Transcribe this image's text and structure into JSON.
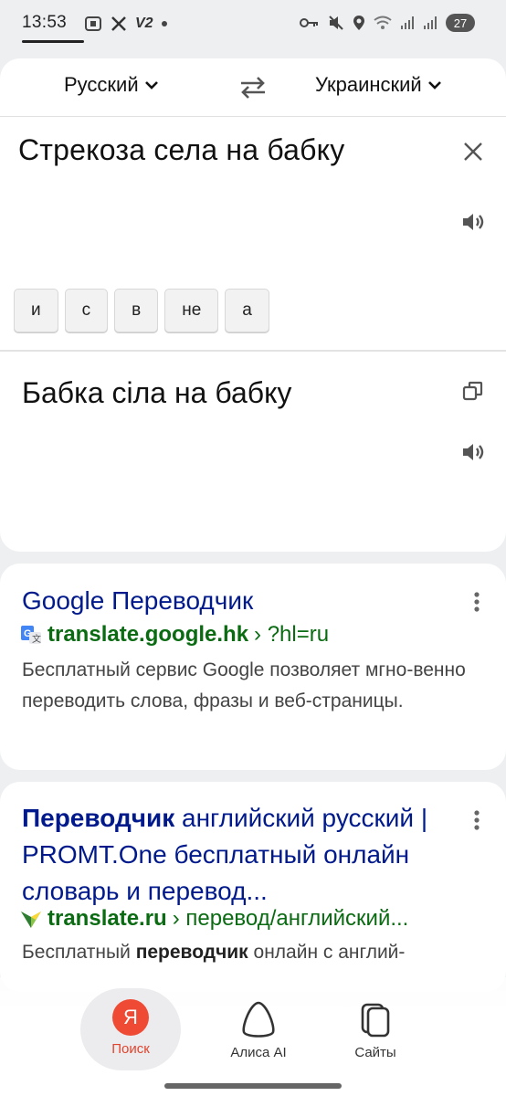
{
  "status_bar": {
    "time": "13:53",
    "carrier_label": "V2",
    "battery": "27"
  },
  "translator": {
    "source_lang": "Русский",
    "target_lang": "Украинский",
    "source_text": "Стрекоза села на бабку",
    "suggestions": [
      "и",
      "с",
      "в",
      "не",
      "а"
    ],
    "translation": "Бабка сіла на бабку"
  },
  "results": [
    {
      "title_bold": "Google Переводчик",
      "title_rest": "",
      "domain": "translate.google.hk",
      "path": "› ?hl=ru",
      "snippet_pre": "Бесплатный сервис Google позволяет мгно-венно переводить слова, фразы и веб-страницы.",
      "snippet_bold": "",
      "snippet_post": "",
      "favicon": "google-translate-icon"
    },
    {
      "title_bold": "Переводчик",
      "title_rest": " английский русский | PROMT.One бесплатный онлайн словарь и перевод...",
      "domain": "translate.ru",
      "path": "› перевод/английский...",
      "snippet_pre": "Бесплатный ",
      "snippet_bold": "переводчик",
      "snippet_post": " онлайн с англий-",
      "favicon": "promt-icon"
    }
  ],
  "bottom_nav": {
    "search": "Поиск",
    "search_logo": "Я",
    "alisa": "Алиса AI",
    "sites": "Сайты"
  },
  "colors": {
    "link_title": "#001a8c",
    "link_url": "#0a6b12",
    "yandex_red": "#ef4b34"
  }
}
